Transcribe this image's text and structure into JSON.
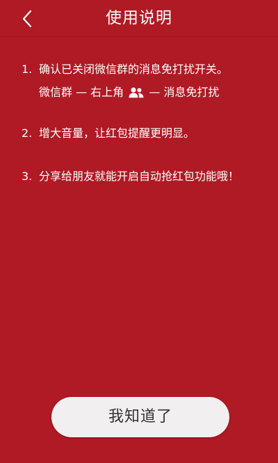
{
  "header": {
    "title": "使用说明",
    "back_icon": "chevron-left-icon"
  },
  "instructions": [
    {
      "num": "1.",
      "text": "确认已关闭微信群的消息免打扰开关。"
    },
    {
      "num": "2.",
      "text": "增大音量，让红包提醒更明显。"
    },
    {
      "num": "3.",
      "text": "分享给朋友就能开启自动抢红包功能哦！"
    }
  ],
  "instruction_1_path": {
    "prefix": "微信群 — 右上角",
    "icon": "people-icon",
    "suffix": "— 消息免打扰"
  },
  "ok_button": {
    "label": "我知道了"
  },
  "colors": {
    "background": "#b01a24",
    "button": "#f1efef",
    "button_text": "#333333"
  }
}
